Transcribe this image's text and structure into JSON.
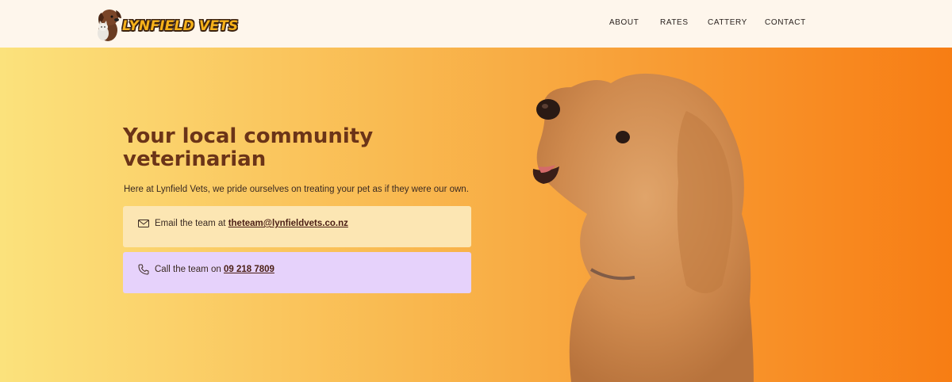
{
  "brand": {
    "name": "LYNFIELD VETS"
  },
  "nav": [
    {
      "label": "ABOUT"
    },
    {
      "label": "RATES"
    },
    {
      "label": "CATTERY"
    },
    {
      "label": "CONTACT"
    }
  ],
  "hero": {
    "heading": "Your local community veterinarian",
    "lead": "Here at Lynfield Vets, we pride ourselves on treating your pet as if they were our own.",
    "email": {
      "prefix": "Email the team at",
      "link": "theteam@lynfieldvets.co.nz",
      "icon": "envelope-icon"
    },
    "phone": {
      "prefix": "Call the team on",
      "link": "09 218 7809",
      "icon": "phone-icon"
    }
  },
  "colors": {
    "header_bg": "#fef6ec",
    "heading": "#6b3418",
    "gradient_start": "#fbe27c",
    "gradient_end": "#f77d14",
    "email_card": "#fce6b3",
    "phone_card": "#e6d2fb"
  }
}
